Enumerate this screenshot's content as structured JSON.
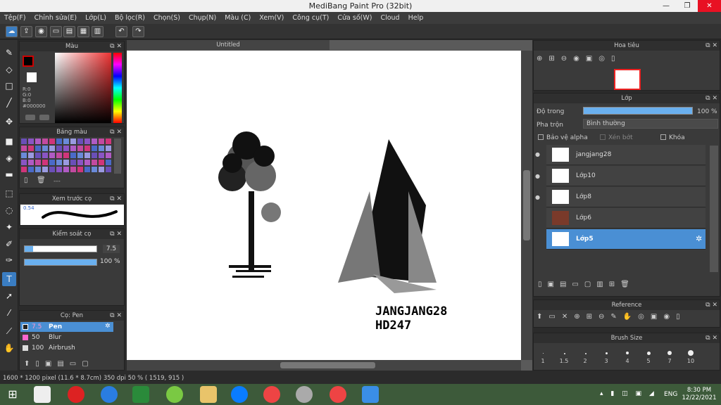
{
  "window": {
    "title": "MediBang Paint Pro (32bit)",
    "minimize": "—",
    "maximize": "❐",
    "close": "✕"
  },
  "menu": [
    "Tệp(F)",
    "Chỉnh sửa(E)",
    "Lớp(L)",
    "Bộ lọc(R)",
    "Chọn(S)",
    "Chụp(N)",
    "Màu (C)",
    "Xem(V)",
    "Công cụ(T)",
    "Cửa số(W)",
    "Cloud",
    "Help"
  ],
  "panels": {
    "color": {
      "title": "Màu",
      "r": "R:0",
      "g": "G:0",
      "b": "B:0",
      "hex": "#000000"
    },
    "palette": {
      "title": "Bảng màu",
      "extra": "---"
    },
    "preview": {
      "title": "Xem trước cọ",
      "size": "0.54"
    },
    "brushctl": {
      "title": "Kiểm soát cọ",
      "size": "7.5",
      "opacity": "100 %"
    },
    "brushes": {
      "title": "Cọ: Pen",
      "items": [
        {
          "size": "7.5",
          "name": "Pen"
        },
        {
          "size": "50",
          "name": "Blur"
        },
        {
          "size": "100",
          "name": "Airbrush"
        }
      ]
    },
    "nav": {
      "title": "Hoa tiêu"
    },
    "layers": {
      "title": "Lớp",
      "opacity_label": "Độ trong",
      "opacity_value": "100 %",
      "blend_label": "Pha trộn",
      "blend_value": "Bình thường",
      "protect_alpha": "Bảo vệ alpha",
      "clip": "Xén bớt",
      "lock": "Khóa",
      "items": [
        {
          "name": "jangjang28"
        },
        {
          "name": "Lớp10"
        },
        {
          "name": "Lớp8"
        },
        {
          "name": "Lớp6"
        },
        {
          "name": "Lớp5"
        }
      ]
    },
    "reference": {
      "title": "Reference"
    },
    "brushsize": {
      "title": "Brush Size",
      "sizes": [
        "1",
        "1.5",
        "2",
        "3",
        "4",
        "5",
        "7",
        "10"
      ]
    }
  },
  "document": {
    "tab": "Untitled",
    "signature_line1": "JANGJANG28",
    "signature_line2": "HD247"
  },
  "status": "1600 * 1200 pixel  (11.6 * 8.7cm)  350 dpi  50 %  ( 1519, 915 )",
  "taskbar": {
    "lang": "ENG",
    "time": "8:30 PM",
    "date": "12/22/2021"
  },
  "colors": {
    "accent": "#4a8fd4",
    "bg": "#2b2b2b"
  }
}
